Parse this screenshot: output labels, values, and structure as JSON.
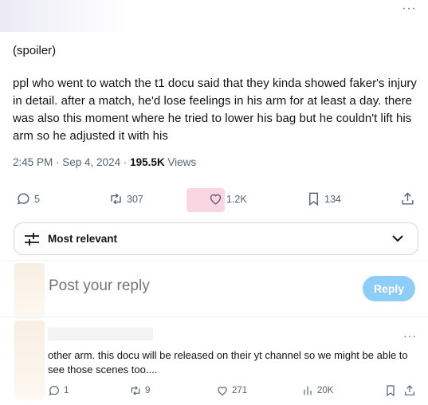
{
  "post": {
    "spoiler": "(spoiler)",
    "text": "ppl who went to watch the t1 docu said that they kinda showed faker's injury in detail. after a match, he'd lose feelings in his arm for at least a day. there was also this moment where he tried to lower his bag but he couldn't lift his arm so he adjusted it with his",
    "time": "2:45 PM · Sep 4, 2024 · ",
    "views_count": "195.5K",
    "views_label": " Views"
  },
  "actions": {
    "replies": "5",
    "reposts": "307",
    "likes": "1.2K",
    "bookmarks": "134"
  },
  "sort": {
    "label": "Most relevant"
  },
  "composer": {
    "placeholder": "Post your reply",
    "button": "Reply"
  },
  "reply": {
    "text": "other arm. this docu will be released on their yt channel so we might be able to see those scenes too....",
    "replies": "1",
    "reposts": "9",
    "likes": "271",
    "views": "20K"
  },
  "colors": {
    "accent": "#1d9bf0",
    "reply_button": "#8ecdf8",
    "muted": "#536471"
  }
}
